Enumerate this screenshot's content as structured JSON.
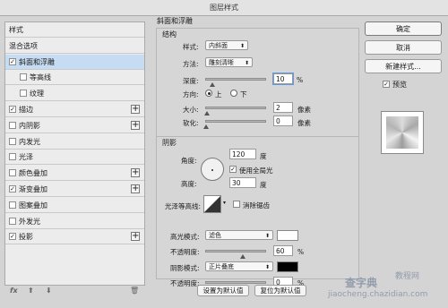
{
  "window": {
    "title": "图层样式"
  },
  "left_panel": {
    "items": [
      {
        "label": "样式",
        "checkbox": false,
        "checked": false,
        "indent": false,
        "selected": false,
        "plus": false
      },
      {
        "label": "混合选项",
        "checkbox": false,
        "checked": false,
        "indent": false,
        "selected": false,
        "plus": false
      },
      {
        "label": "斜面和浮雕",
        "checkbox": true,
        "checked": true,
        "indent": false,
        "selected": true,
        "plus": false
      },
      {
        "label": "等高线",
        "checkbox": true,
        "checked": false,
        "indent": true,
        "selected": false,
        "plus": false
      },
      {
        "label": "纹理",
        "checkbox": true,
        "checked": false,
        "indent": true,
        "selected": false,
        "plus": false
      },
      {
        "label": "描边",
        "checkbox": true,
        "checked": true,
        "indent": false,
        "selected": false,
        "plus": true
      },
      {
        "label": "内阴影",
        "checkbox": true,
        "checked": false,
        "indent": false,
        "selected": false,
        "plus": true
      },
      {
        "label": "内发光",
        "checkbox": true,
        "checked": false,
        "indent": false,
        "selected": false,
        "plus": false
      },
      {
        "label": "光泽",
        "checkbox": true,
        "checked": false,
        "indent": false,
        "selected": false,
        "plus": false
      },
      {
        "label": "颜色叠加",
        "checkbox": true,
        "checked": false,
        "indent": false,
        "selected": false,
        "plus": true
      },
      {
        "label": "渐变叠加",
        "checkbox": true,
        "checked": true,
        "indent": false,
        "selected": false,
        "plus": true
      },
      {
        "label": "图案叠加",
        "checkbox": true,
        "checked": false,
        "indent": false,
        "selected": false,
        "plus": false
      },
      {
        "label": "外发光",
        "checkbox": true,
        "checked": false,
        "indent": false,
        "selected": false,
        "plus": false
      },
      {
        "label": "投影",
        "checkbox": true,
        "checked": true,
        "indent": false,
        "selected": false,
        "plus": true
      }
    ],
    "footer": {
      "fx": "fx",
      "up": "⬆",
      "down": "⬇",
      "trash": "🗑"
    }
  },
  "bevel": {
    "section_title": "斜面和浮雕",
    "structure_title": "结构",
    "style_label": "样式:",
    "style_value": "内斜面",
    "method_label": "方法:",
    "method_value": "雕刻清晰",
    "depth_label": "深度:",
    "depth_value": "10",
    "depth_level": 0.1,
    "depth_unit": "%",
    "direction_label": "方向:",
    "dir_up": "上",
    "dir_down": "下",
    "size_label": "大小:",
    "size_value": "2",
    "size_unit": "像素",
    "soften_label": "软化:",
    "soften_value": "0",
    "soften_unit": "像素"
  },
  "shading": {
    "title": "阴影",
    "angle_label": "角度:",
    "angle_value": "120",
    "angle_unit": "度",
    "global_light_label": "使用全局光",
    "altitude_label": "高度:",
    "altitude_value": "30",
    "altitude_unit": "度",
    "gloss_label": "光泽等高线:",
    "antialias_label": "消除锯齿",
    "highlight_mode_label": "高光模式:",
    "highlight_mode_value": "滤色",
    "highlight_opacity_label": "不透明度:",
    "highlight_opacity_value": "60",
    "highlight_opacity_unit": "%",
    "shadow_mode_label": "阴影模式:",
    "shadow_mode_value": "正片叠底",
    "shadow_opacity_label": "不透明度:",
    "shadow_opacity_value": "0",
    "shadow_opacity_unit": "%",
    "highlight_color": "#ffffff",
    "shadow_color": "#000000"
  },
  "bottom_buttons": {
    "set_default": "设置为默认值",
    "reset_default": "复位为默认值"
  },
  "right": {
    "ok": "确定",
    "cancel": "取消",
    "new_style": "新建样式...",
    "preview_label": "预览"
  },
  "watermark": {
    "line1": "查字典",
    "line2": "jiaocheng.chazidian.com",
    "line3": "教程网"
  }
}
